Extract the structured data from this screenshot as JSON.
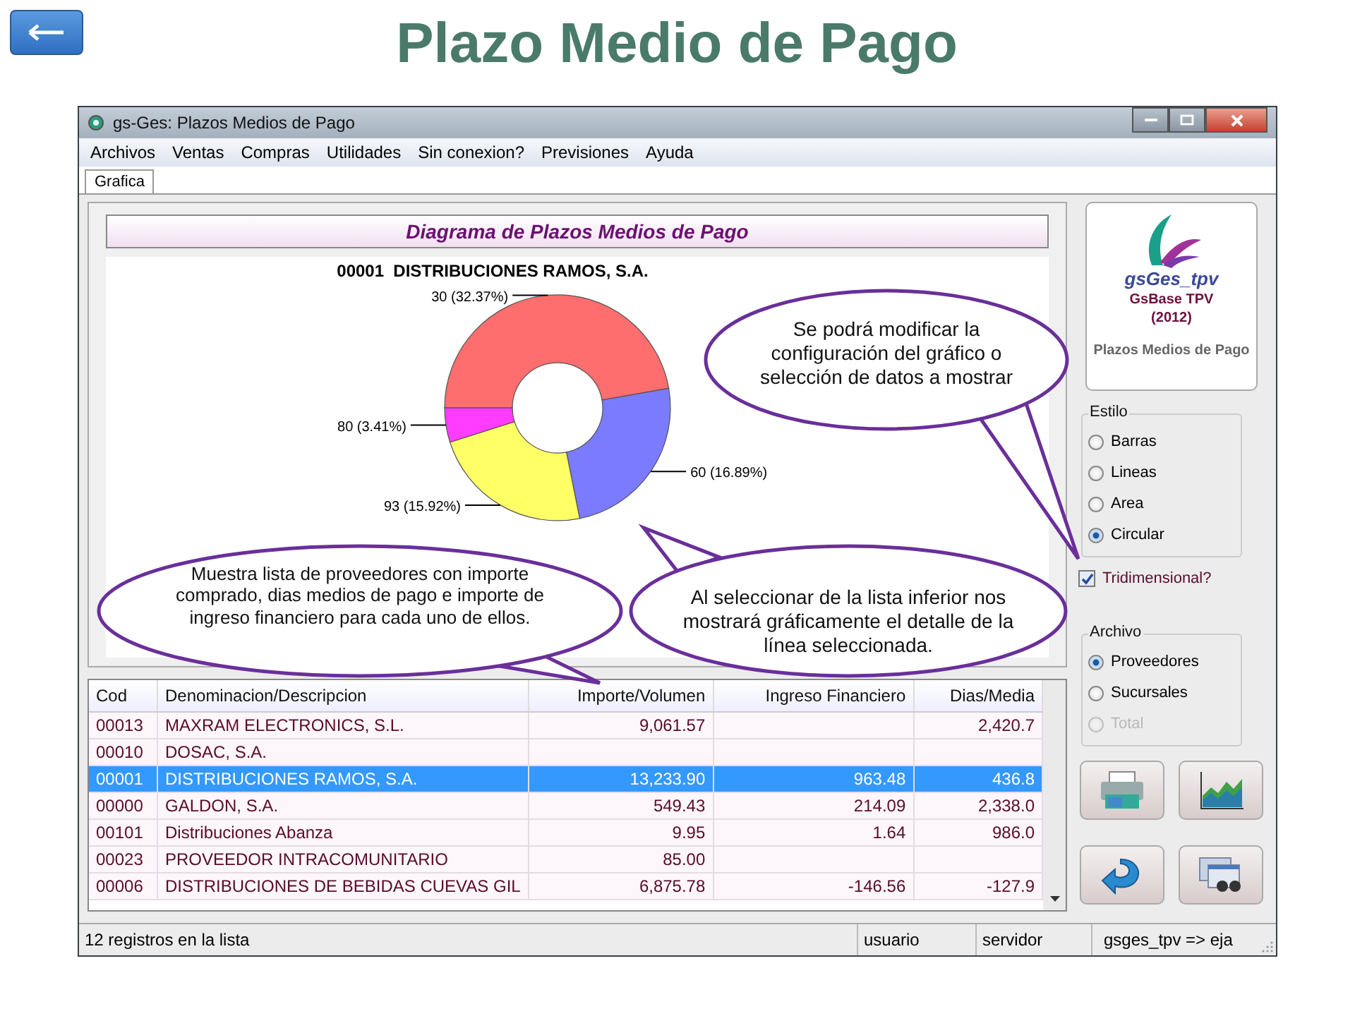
{
  "slide": {
    "title": "Plazo Medio de Pago"
  },
  "window": {
    "title": "gs-Ges: Plazos Medios de Pago"
  },
  "menu": [
    "Archivos",
    "Ventas",
    "Compras",
    "Utilidades",
    "Sin conexion?",
    "Previsiones",
    "Ayuda"
  ],
  "tabs": [
    {
      "label": "Grafica",
      "selected": true
    }
  ],
  "chart_panel": {
    "heading": "Diagrama de Plazos Medios de Pago",
    "chart_data": {
      "type": "donut",
      "title": "00001  DISTRIBUCIONES RAMOS, S.A.",
      "values": [
        16.89,
        15.92,
        3.41,
        32.37
      ],
      "value_labels": [
        "60 (16.89%)",
        "93 (15.92%)",
        "80 (3.41%)",
        "30 (32.37%)"
      ]
    }
  },
  "side_panel": {
    "logo_name": "gsGes_tpv",
    "product": "GsBase TPV",
    "year": "(2012)",
    "module": "Plazos Medios de Pago",
    "style_group": {
      "label": "Estilo",
      "options": [
        {
          "label": "Barras",
          "selected": false
        },
        {
          "label": "Lineas",
          "selected": false
        },
        {
          "label": "Area",
          "selected": false
        },
        {
          "label": "Circular",
          "selected": true
        }
      ]
    },
    "three_d": {
      "label": "Tridimensional?",
      "checked": true
    },
    "file_group": {
      "label": "Archivo",
      "options": [
        {
          "label": "Proveedores",
          "selected": true,
          "disabled": false
        },
        {
          "label": "Sucursales",
          "selected": false,
          "disabled": false
        },
        {
          "label": "Total",
          "selected": false,
          "disabled": true
        }
      ]
    }
  },
  "table": {
    "columns": [
      "Cod",
      "Denominacion/Descripcion",
      "Importe/Volumen",
      "Ingreso Financiero",
      "Dias/Media"
    ],
    "rows": [
      {
        "cod": "00013",
        "name": "MAXRAM ELECTRONICS, S.L.",
        "importe": "9,061.57",
        "dias": "2,420.7",
        "selected": false
      },
      {
        "cod": "00010",
        "name": "DOSAC, S.A.",
        "selected": false
      },
      {
        "cod": "00001",
        "name": "DISTRIBUCIONES RAMOS, S.A.",
        "importe": "13,233.90",
        "ingreso": "963.48",
        "dias": "436.8",
        "selected": true
      },
      {
        "cod": "00000",
        "name": "GALDON, S.A.",
        "importe": "549.43",
        "ingreso": "214.09",
        "dias": "2,338.0",
        "selected": false
      },
      {
        "cod": "00101",
        "name": "Distribuciones Abanza",
        "importe": "9.95",
        "ingreso": "1.64",
        "dias": "986.0",
        "selected": false
      },
      {
        "cod": "00023",
        "name": "PROVEEDOR INTRACOMUNITARIO",
        "importe": "85.00",
        "selected": false
      },
      {
        "cod": "00006",
        "name": "DISTRIBUCIONES DE BEBIDAS CUEVAS GIL",
        "importe": "6,875.78",
        "ingreso": "-146.56",
        "dias": "-127.9",
        "selected": false
      }
    ]
  },
  "status_bar": [
    "12 registros en la lista",
    "usuario",
    "servidor",
    "gsges_tpv => eja"
  ],
  "callouts": [
    {
      "text": "Se podrá modificar la configuración del gráfico o selección de datos a mostrar"
    },
    {
      "text": "Muestra lista de proveedores con importe comprado, dias medios de pago e importe de ingreso financiero para cada uno de ellos."
    },
    {
      "text": "Al seleccionar de la lista inferior nos mostrará gráficamente el detalle de la línea seleccionada."
    }
  ]
}
